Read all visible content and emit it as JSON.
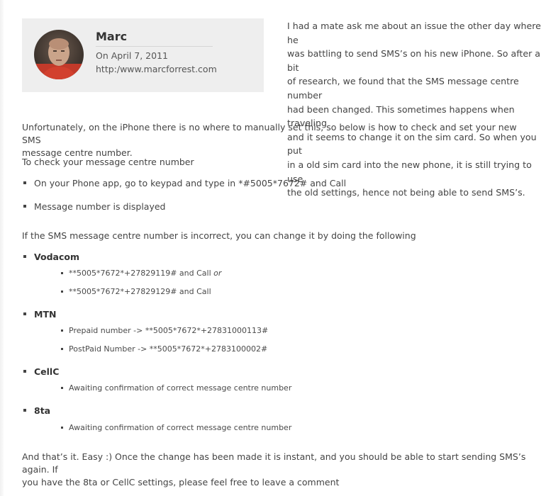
{
  "author": {
    "name": "Marc",
    "date": "On April 7, 2011",
    "website": "http:/www.marcforrest.com",
    "avatar_icon": "person-avatar"
  },
  "intro_lines": [
    "I had a mate ask me about an issue the other day where he",
    "was battling to send SMS’s on his new iPhone. So after a bit",
    "of research, we found that the SMS message centre number",
    "had been changed. This sometimes happens when traveling",
    "and it seems to change it on the sim card. So when you put",
    "in a old sim card into the new phone, it is still trying to use",
    "the old settings, hence not being able to send SMS’s."
  ],
  "paragraph_unfortunately": [
    "Unfortunately, on the iPhone there is no where to manually set this, so below is how to check and set your new SMS",
    "message centre number."
  ],
  "check_heading": "To check your message centre number",
  "check_steps": [
    "On your Phone app, go to keypad and type in *#5005*7672# and Call",
    "Message number is displayed"
  ],
  "change_heading": "If the SMS message centre number is incorrect, you can change it by doing the following",
  "networks": [
    {
      "name": "Vodacom",
      "items": [
        {
          "text": "**5005*7672*+27829119# and Call ",
          "suffix": "or"
        },
        {
          "text": "**5005*7672*+27829129# and Call",
          "suffix": ""
        }
      ]
    },
    {
      "name": "MTN",
      "items": [
        {
          "text": "Prepaid number -> **5005*7672*+27831000113#",
          "suffix": ""
        },
        {
          "text": "PostPaid Number -> **5005*7672*+2783100002#",
          "suffix": ""
        }
      ]
    },
    {
      "name": "CellC",
      "items": [
        {
          "text": "Awaiting confirmation of correct message centre number",
          "suffix": ""
        }
      ]
    },
    {
      "name": "8ta",
      "items": [
        {
          "text": "Awaiting confirmation of correct message centre number",
          "suffix": ""
        }
      ]
    }
  ],
  "closing_lines": [
    "And that’s it. Easy :) Once the change has been made it is instant, and you should be able to start sending SMS’s again. If",
    "you have the 8ta or CellC settings, please feel free to leave a comment"
  ]
}
